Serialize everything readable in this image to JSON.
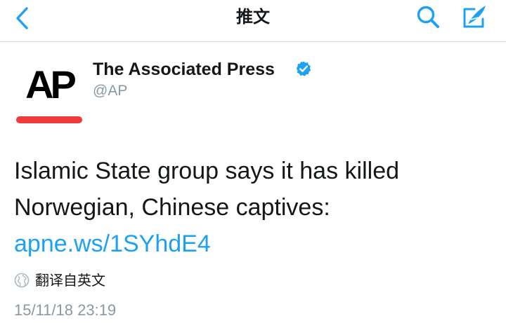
{
  "nav": {
    "title": "推文",
    "back_icon": "chevron-left-icon",
    "search_icon": "search-icon",
    "compose_icon": "compose-feather-icon"
  },
  "author": {
    "avatar_text": "AP",
    "name": "The Associated Press",
    "handle": "@AP",
    "verified_icon": "verified-badge-icon"
  },
  "tweet": {
    "text": "Islamic State group says it has killed Norwegian, Chinese captives: ",
    "link": "apne.ws/1SYhdE4",
    "translate_label": "翻译自英文",
    "translate_icon": "globe-icon",
    "timestamp": "15/11/18 23:19"
  },
  "colors": {
    "accent": "#1da1f2",
    "text": "#14171a",
    "secondary_text": "#8899a6",
    "ap_red": "#ef3b3b",
    "divider": "#d9d9d9"
  }
}
